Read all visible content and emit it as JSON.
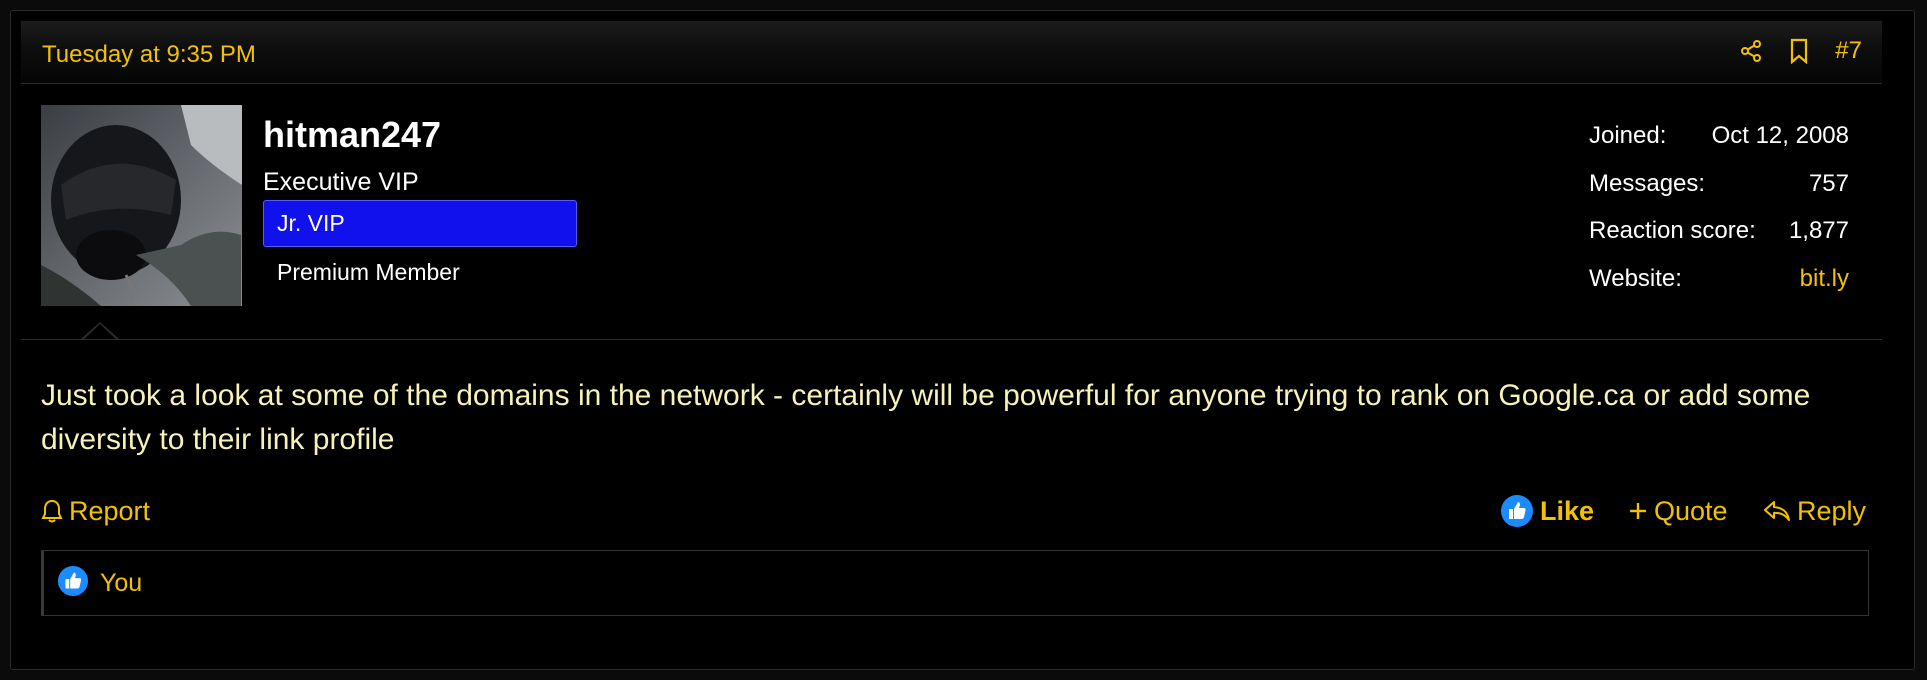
{
  "post": {
    "date": "Tuesday at 9:35 PM",
    "number": "#7"
  },
  "user": {
    "name": "hitman247",
    "title": "Executive VIP",
    "banners": [
      "Jr. VIP",
      "Premium Member"
    ],
    "stats": [
      {
        "label": "Joined:",
        "value": "Oct 12, 2008"
      },
      {
        "label": "Messages:",
        "value": "757"
      },
      {
        "label": "Reaction score:",
        "value": "1,877"
      },
      {
        "label": "Website:",
        "value": "bit.ly"
      }
    ]
  },
  "message": {
    "text": "Just took a look at some of the domains in the network - certainly will be powerful for anyone trying to rank on Google.ca or add some diversity to their link profile"
  },
  "actions": {
    "report": "Report",
    "like": "Like",
    "quote": "Quote",
    "reply": "Reply"
  },
  "reactions": {
    "users": "You"
  },
  "icons": {
    "share": "share-icon",
    "bookmark": "bookmark-icon",
    "report": "bell-icon",
    "like": "thumbs-up-icon",
    "quote": "plus-icon",
    "reply": "reply-arrow-icon"
  },
  "colors": {
    "accent": "#f2c200",
    "banner": "#1111ee",
    "like_badge": "#1a8cff",
    "message_text": "#f7f2b8"
  }
}
